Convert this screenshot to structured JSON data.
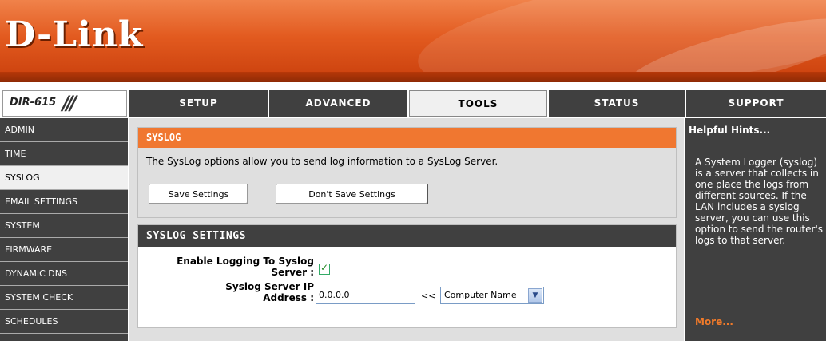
{
  "brand": {
    "logo_text": "D-Link"
  },
  "header": {
    "model": "DIR-615",
    "model_slashes": "///"
  },
  "nav": {
    "tabs": [
      {
        "label": "SETUP"
      },
      {
        "label": "ADVANCED"
      },
      {
        "label": "TOOLS",
        "active": true
      },
      {
        "label": "STATUS"
      },
      {
        "label": "SUPPORT"
      }
    ]
  },
  "sidebar": {
    "items": [
      {
        "label": "ADMIN"
      },
      {
        "label": "TIME"
      },
      {
        "label": "SYSLOG",
        "active": true
      },
      {
        "label": "EMAIL SETTINGS"
      },
      {
        "label": "SYSTEM"
      },
      {
        "label": "FIRMWARE"
      },
      {
        "label": "DYNAMIC DNS"
      },
      {
        "label": "SYSTEM CHECK"
      },
      {
        "label": "SCHEDULES"
      }
    ]
  },
  "main": {
    "syslog_section": {
      "title": "SYSLOG",
      "description": "The SysLog options allow you to send log information to a SysLog Server.",
      "save_label": "Save Settings",
      "dont_save_label": "Don't Save Settings"
    },
    "settings_section": {
      "title": "SYSLOG SETTINGS",
      "enable_label_line1": "Enable Logging To Syslog",
      "enable_label_line2": "Server :",
      "enable_checked": true,
      "ip_label_line1": "Syslog Server IP",
      "ip_label_line2": "Address :",
      "ip_value": "0.0.0.0",
      "copy_arrows": "<<",
      "computer_select_value": "Computer Name"
    }
  },
  "help": {
    "title": "Helpful Hints...",
    "text": "A System Logger (syslog) is a server that collects in one place the logs from different sources. If the LAN includes a syslog server, you can use this option to send the router's logs to that server.",
    "more": "More..."
  },
  "colors": {
    "banner_orange": "#e25a1f",
    "section_orange": "#f07730",
    "dark_gray": "#404040",
    "panel_gray": "#dfdfdf",
    "more_link": "#f07a2a"
  }
}
